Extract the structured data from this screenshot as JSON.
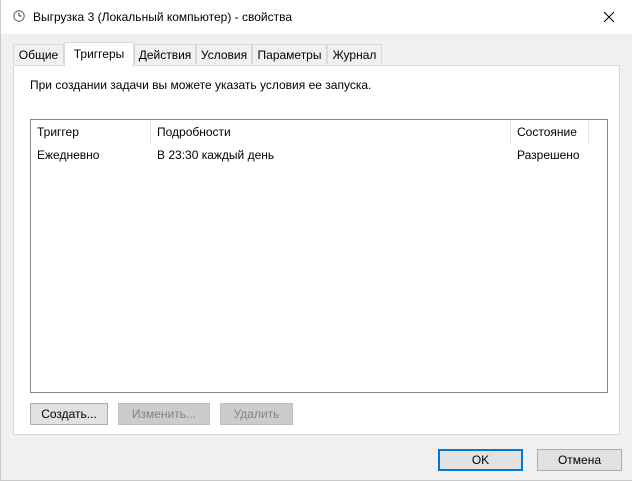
{
  "window": {
    "title": "Выгрузка 3 (Локальный компьютер) - свойства"
  },
  "tabs": [
    {
      "label": "Общие",
      "active": false
    },
    {
      "label": "Триггеры",
      "active": true
    },
    {
      "label": "Действия",
      "active": false
    },
    {
      "label": "Условия",
      "active": false
    },
    {
      "label": "Параметры",
      "active": false
    },
    {
      "label": "Журнал",
      "active": false
    }
  ],
  "triggers_tab": {
    "intro": "При создании задачи вы можете указать условия ее запуска.",
    "columns": [
      "Триггер",
      "Подробности",
      "Состояние"
    ],
    "rows": [
      {
        "trigger": "Ежедневно",
        "details": "В 23:30 каждый день",
        "state": "Разрешено"
      }
    ],
    "buttons": {
      "create": "Создать...",
      "edit": "Изменить...",
      "delete": "Удалить"
    }
  },
  "footer": {
    "ok": "OK",
    "cancel": "Отмена"
  },
  "colors": {
    "accent": "#0078d7",
    "panel_bg": "#ffffff",
    "dialog_bg": "#f0f0f0"
  },
  "icons": {
    "title": "clock-icon",
    "close": "close-icon"
  }
}
